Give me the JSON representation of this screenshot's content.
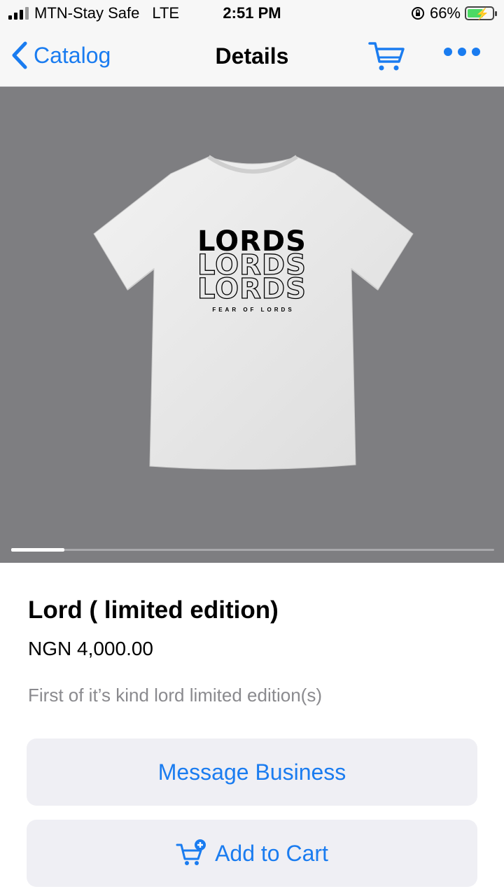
{
  "status_bar": {
    "carrier": "MTN-Stay Safe",
    "network": "LTE",
    "time": "2:51 PM",
    "battery_percent": "66%",
    "battery_level": 0.66,
    "icons": [
      "signal-icon",
      "orientation-lock-icon",
      "battery-charging-icon"
    ]
  },
  "nav": {
    "back_label": "Catalog",
    "title": "Details",
    "icons": [
      "chevron-left-icon",
      "cart-icon",
      "more-icon"
    ]
  },
  "product": {
    "image": {
      "print_main": "LORDS",
      "print_tagline": "FEAR OF LORDS",
      "page_index": 1,
      "page_fraction": 0.11
    },
    "title": "Lord ( limited edition)",
    "price": "NGN 4,000.00",
    "description": "First of it’s kind lord limited edition(s)"
  },
  "actions": {
    "message_label": "Message Business",
    "add_to_cart_label": "Add to Cart"
  },
  "colors": {
    "accent": "#1a7cf0",
    "image_background": "#7e7e81",
    "button_background": "#efeff4",
    "muted_text": "#8a8a8e"
  }
}
